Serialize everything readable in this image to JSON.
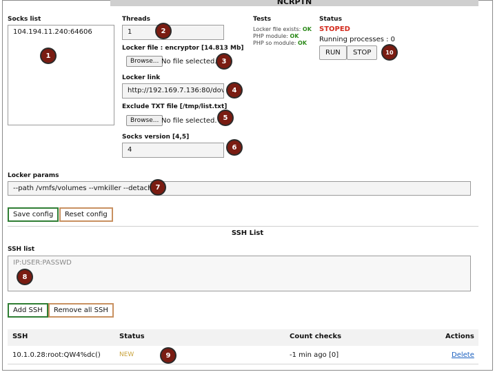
{
  "title": "NCRPTN",
  "socks": {
    "label": "Socks list",
    "value": "104.194.11.240:64606"
  },
  "threads": {
    "label": "Threads",
    "value": "1"
  },
  "locker_file": {
    "label": "Locker file : encryptor [14.813 Mb]",
    "browse": "Browse...",
    "status": "No file selected."
  },
  "locker_link": {
    "label": "Locker link",
    "value": "http://192.169.7.136:80/dov"
  },
  "exclude": {
    "label": "Exclude TXT file [/tmp/list.txt]",
    "browse": "Browse...",
    "status": "No file selected."
  },
  "socks_version": {
    "label": "Socks version [4,5]",
    "value": "4"
  },
  "tests": {
    "label": "Tests",
    "rows": [
      {
        "name": "Locker file exists:",
        "result": "OK"
      },
      {
        "name": "PHP module:",
        "result": "OK"
      },
      {
        "name": "PHP so module:",
        "result": "OK"
      }
    ]
  },
  "status": {
    "label": "Status",
    "state": "STOPED",
    "processes": "Running processes : 0",
    "run": "RUN",
    "stop": "STOP"
  },
  "locker_params": {
    "label": "Locker params",
    "value": "--path /vmfs/volumes --vmkiller --detach"
  },
  "config": {
    "save": "Save config",
    "reset": "Reset config"
  },
  "ssh": {
    "heading": "SSH List",
    "list_label": "SSH list",
    "placeholder": "IP:USER:PASSWD",
    "add": "Add SSH",
    "remove_all": "Remove all SSH",
    "columns": [
      "SSH",
      "Status",
      "Count checks",
      "Actions"
    ],
    "rows": [
      {
        "ssh": "10.1.0.28:root:QW4%dc()",
        "status": "NEW",
        "checks": "-1 min ago [0]",
        "action": "Delete"
      }
    ]
  },
  "badges": [
    "1",
    "2",
    "3",
    "4",
    "5",
    "6",
    "7",
    "8",
    "9",
    "10"
  ],
  "colors": {
    "stoped": "#d42b1e",
    "ok": "#2c8a1a",
    "new": "#c8a23a",
    "link": "#1a5fbf",
    "badge": "#7a1c12"
  }
}
